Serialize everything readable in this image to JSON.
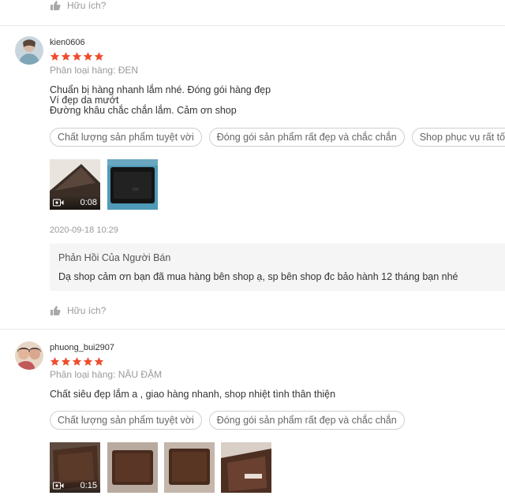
{
  "helpful_label": "Hữu ích?",
  "reviews": [
    {
      "username": "kien0606",
      "rating": 5,
      "variation": "Phân loại hàng: ĐEN",
      "comment_lines": [
        "Chuẩn bị hàng nhanh lắm nhé. Đóng gói hàng đẹp",
        "Ví đẹp da mướt",
        "Đường khâu chắc chắn lắm. Cảm ơn shop"
      ],
      "tags": [
        "Chất lượng sản phẩm tuyệt vời",
        "Đóng gói sản phẩm rất đẹp và chắc chắn",
        "Shop phục vụ rất tốt"
      ],
      "video_duration": "0:08",
      "timestamp": "2020-09-18 10:29",
      "seller_reply": {
        "title": "Phản Hồi Của Người Bán",
        "body": "Dạ shop cảm ơn bạn đã mua hàng bên shop ạ, sp bên shop đc bảo hành 12 tháng bạn nhé"
      }
    },
    {
      "username": "phuong_bui2907",
      "rating": 5,
      "variation": "Phân loại hàng: NÂU ĐẬM",
      "comment_lines": [
        "Chất siêu đẹp  lắm a , giao hàng nhanh, shop nhiệt tình thân thiện"
      ],
      "tags": [
        "Chất lượng sản phẩm tuyệt vời",
        "Đóng gói sản phẩm rất đẹp và chắc chắn"
      ],
      "video_duration": "0:15"
    }
  ],
  "colors": {
    "star": "#ee4d2d",
    "muted": "#9a9a9a",
    "reply_bg": "#f5f5f5"
  }
}
